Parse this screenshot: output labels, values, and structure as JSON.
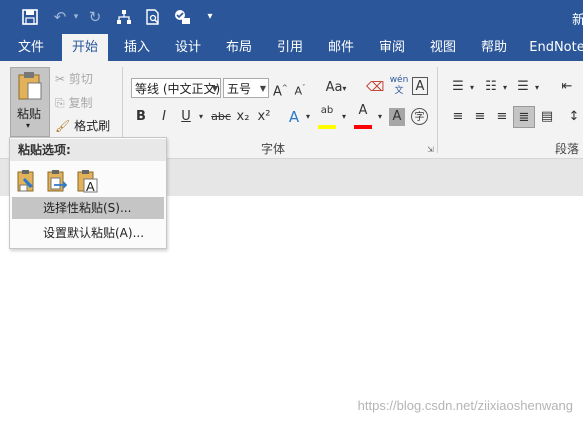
{
  "title_bar": {
    "title_fragment": "新",
    "qat_icons": [
      "save-icon",
      "undo-icon",
      "redo-icon",
      "structure-icon",
      "print-preview-icon",
      "check-icon",
      "customize-icon"
    ]
  },
  "tabs": [
    "文件",
    "开始",
    "插入",
    "设计",
    "布局",
    "引用",
    "邮件",
    "审阅",
    "视图",
    "帮助",
    "EndNote"
  ],
  "active_tab": "开始",
  "clipboard": {
    "paste_label": "粘贴",
    "cut": "剪切",
    "copy": "复制",
    "format_painter": "格式刷"
  },
  "font": {
    "font_name": "等线 (中文正文)",
    "font_size": "五号",
    "group_label": "字体",
    "buttons": {
      "bold": "B",
      "italic": "I",
      "underline": "U",
      "strike": "abc",
      "subscript": "x₂",
      "superscript": "x²",
      "clear": "A",
      "pinyin": "wén 文",
      "border_char": "A",
      "case": "Aa",
      "grow": "A",
      "shrink": "A",
      "effects": "A",
      "highlight": "ab",
      "color": "A",
      "shading": "A",
      "enclose": "字"
    },
    "colors": {
      "highlight": "#ffff00",
      "font_color": "#ff0000"
    }
  },
  "paragraph": {
    "group_label": "段落"
  },
  "paste_menu": {
    "header": "粘贴选项:",
    "options": [
      "keep-source-formatting-icon",
      "merge-formatting-icon",
      "keep-text-only-icon"
    ],
    "items": [
      {
        "label": "选择性粘贴(S)...",
        "highlighted": true
      },
      {
        "label": "设置默认粘贴(A)...",
        "highlighted": false
      }
    ]
  },
  "watermark": "https://blog.csdn.net/ziixiaoshenwang"
}
